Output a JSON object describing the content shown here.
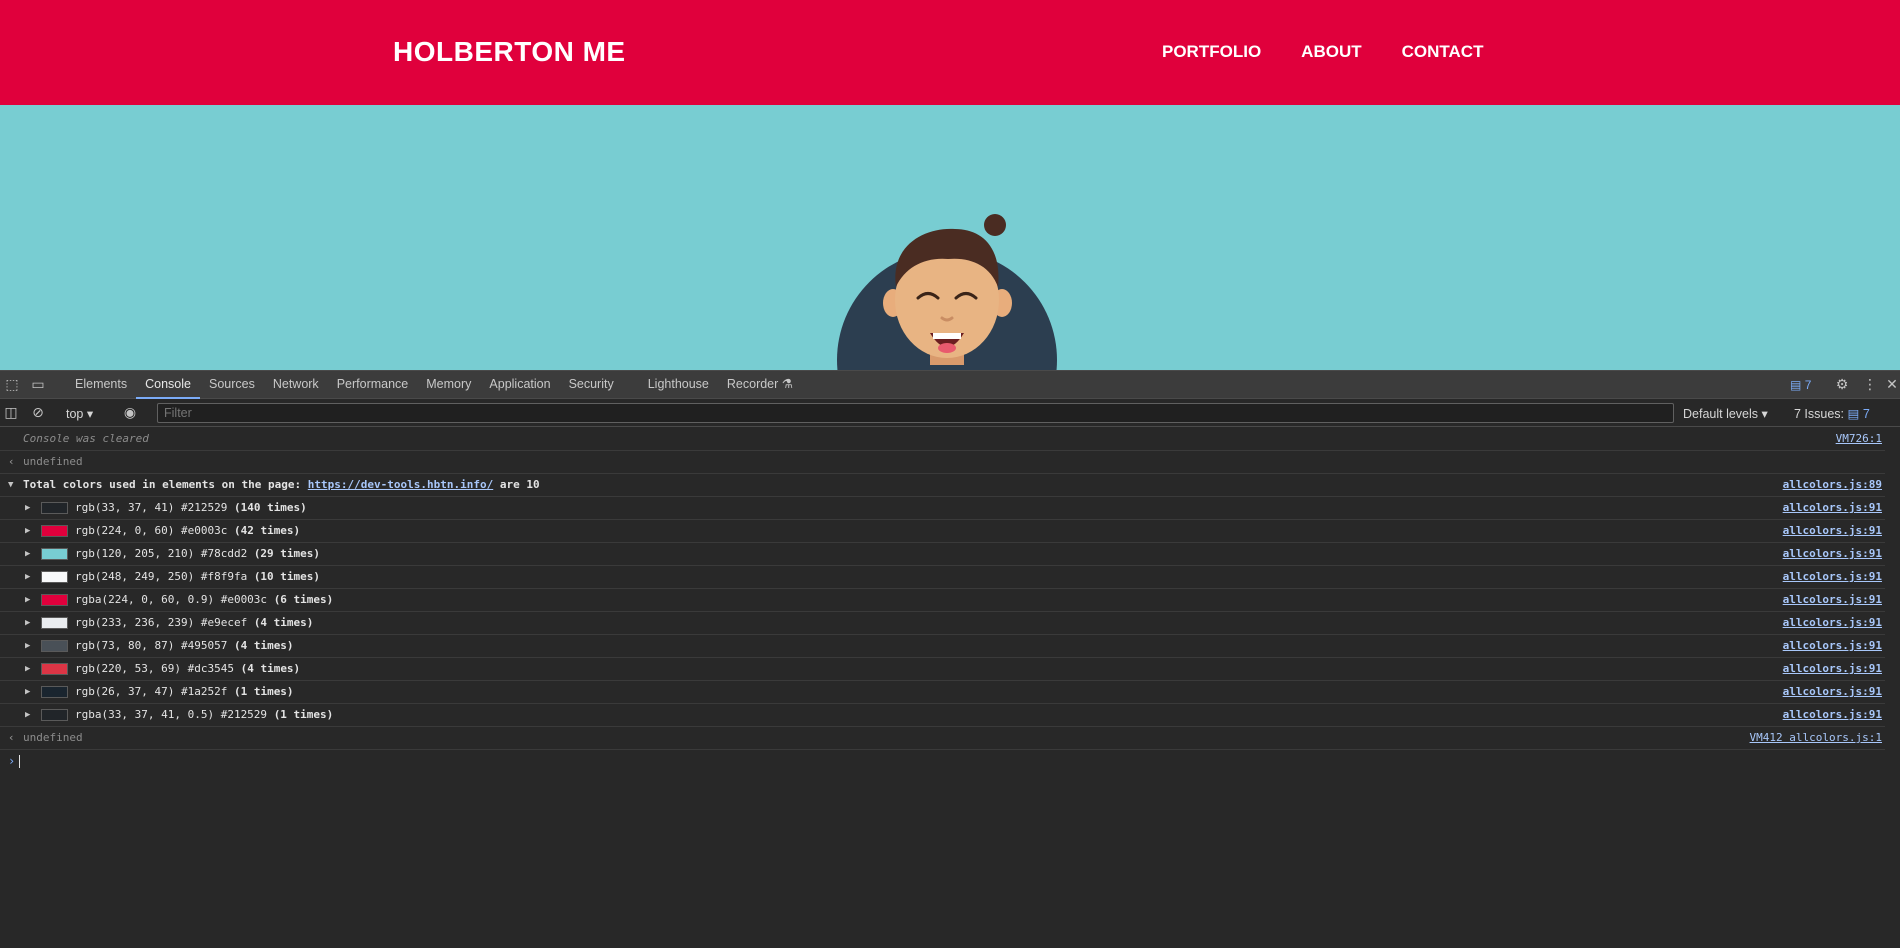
{
  "site": {
    "brand": "HOLBERTON ME",
    "nav": [
      "PORTFOLIO",
      "ABOUT",
      "CONTACT"
    ],
    "colors": {
      "header": "#e0003c",
      "hero": "#78cdd2"
    }
  },
  "devtools": {
    "tabs": [
      "Elements",
      "Console",
      "Sources",
      "Network",
      "Performance",
      "Memory",
      "Application",
      "Security",
      "Lighthouse",
      "Recorder"
    ],
    "active_tab": "Console",
    "issues_badge": "7",
    "context": "top",
    "filter_placeholder": "Filter",
    "levels": "Default levels",
    "issues_label": "7 Issues:",
    "issues_num": "7"
  },
  "console": {
    "cleared": "Console was cleared",
    "cleared_src": "VM726:1",
    "undefined": "undefined",
    "summary_prefix": "Total colors used in elements on the page:",
    "summary_url": "https://dev-tools.hbtn.info/",
    "summary_suffix": "are 10",
    "summary_src": "allcolors.js:89",
    "rows": [
      {
        "text": "rgb(33, 37, 41) #212529",
        "count": "(140 times)",
        "color": "#212529",
        "src": "allcolors.js:91"
      },
      {
        "text": "rgb(224, 0, 60) #e0003c",
        "count": "(42 times)",
        "color": "#e0003c",
        "src": "allcolors.js:91"
      },
      {
        "text": "rgb(120, 205, 210) #78cdd2",
        "count": "(29 times)",
        "color": "#78cdd2",
        "src": "allcolors.js:91"
      },
      {
        "text": "rgb(248, 249, 250) #f8f9fa",
        "count": "(10 times)",
        "color": "#f8f9fa",
        "src": "allcolors.js:91"
      },
      {
        "text": "rgba(224, 0, 60, 0.9) #e0003c",
        "count": "(6 times)",
        "color": "#e0003c",
        "src": "allcolors.js:91"
      },
      {
        "text": "rgb(233, 236, 239) #e9ecef",
        "count": "(4 times)",
        "color": "#e9ecef",
        "src": "allcolors.js:91"
      },
      {
        "text": "rgb(73, 80, 87) #495057",
        "count": "(4 times)",
        "color": "#495057",
        "src": "allcolors.js:91"
      },
      {
        "text": "rgb(220, 53, 69) #dc3545",
        "count": "(4 times)",
        "color": "#dc3545",
        "src": "allcolors.js:91"
      },
      {
        "text": "rgb(26, 37, 47) #1a252f",
        "count": "(1 times)",
        "color": "#1a252f",
        "src": "allcolors.js:91"
      },
      {
        "text": "rgba(33, 37, 41, 0.5) #212529",
        "count": "(1 times)",
        "color": "#212529",
        "src": "allcolors.js:91"
      }
    ],
    "final_src": "VM412 allcolors.js:1"
  }
}
